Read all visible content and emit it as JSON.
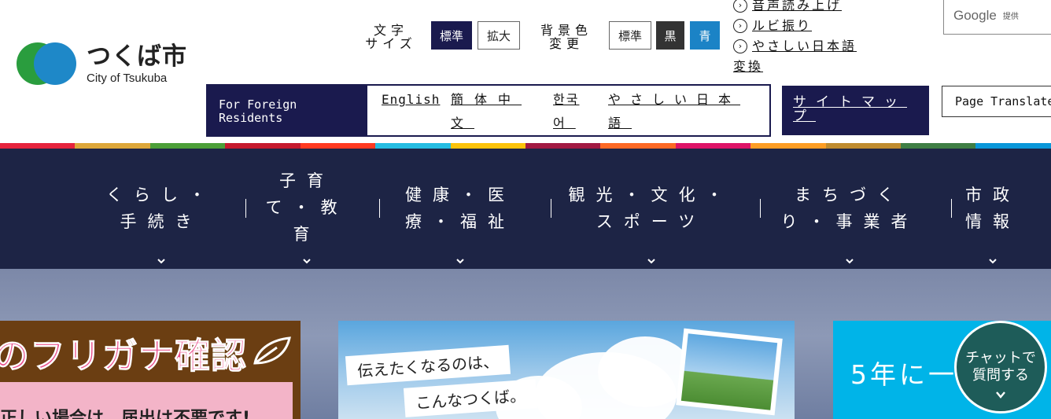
{
  "logo": {
    "jp": "つくば市",
    "en": "City of Tsukuba"
  },
  "controls": {
    "text_size_label_1": "文字",
    "text_size_label_2": "サイズ",
    "text_standard": "標準",
    "text_large": "拡大",
    "bg_label_1": "背景色",
    "bg_label_2": "変更",
    "bg_standard": "標準",
    "bg_black": "黒",
    "bg_blue": "青"
  },
  "access_links": {
    "speech": "音声読み上げ",
    "ruby": "ルビ振り",
    "easy_jp_1": "やさしい日本語",
    "easy_jp_2": "変換"
  },
  "google": {
    "word": "Google",
    "sub": "提供"
  },
  "foreign": {
    "label_1": "For Foreign",
    "label_2": "Residents",
    "links": [
      "English",
      "簡体中",
      "文",
      "한국",
      "어",
      "やさしい日本",
      "語"
    ]
  },
  "sitemap": {
    "line1": "サイトマッ",
    "line2": "プ"
  },
  "page_translate": "Page Translate",
  "stripe_colors": [
    "#e5233d",
    "#dda73a",
    "#4c9f38",
    "#c5192d",
    "#ff3a21",
    "#26bde2",
    "#fcc30b",
    "#a21942",
    "#fd6925",
    "#dd1367",
    "#fd9d24",
    "#bf8b2e",
    "#3f7e44",
    "#0a97d9"
  ],
  "nav": [
    {
      "line1": "くらし・",
      "line2": "手続き",
      "line3": ""
    },
    {
      "line1": "子育",
      "line2": "て・教",
      "line3": "育"
    },
    {
      "line1": "健康・医",
      "line2": "療・福祉",
      "line3": ""
    },
    {
      "line1": "観光・文化・",
      "line2": "スポーツ",
      "line3": ""
    },
    {
      "line1": "まちづく",
      "line2": "り・事業者",
      "line3": ""
    },
    {
      "line1": "市政",
      "line2": "情報",
      "line3": ""
    }
  ],
  "hero": {
    "card1_title": "のフリガナ確認",
    "card1_sub": "正しい場合は、届出は不要です!",
    "card2_line1": "伝えたくなるのは、",
    "card2_line2": "こんなつくば。",
    "card3_text": "5年に一",
    "chat_line1": "チャットで",
    "chat_line2": "質問する"
  }
}
